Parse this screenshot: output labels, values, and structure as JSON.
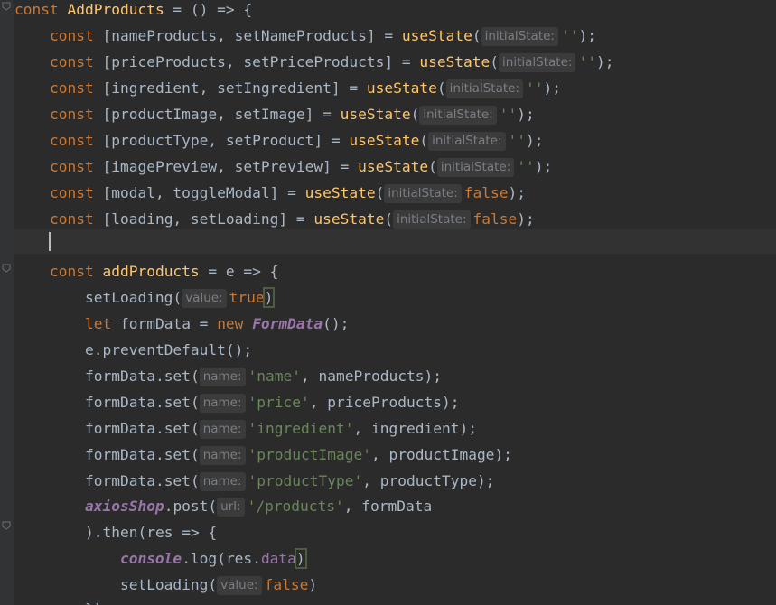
{
  "editor": {
    "indent": "    ",
    "hint_labels": {
      "initial_state": "initialState:",
      "value": "value:",
      "name": "name:",
      "url": "url:"
    },
    "keywords": {
      "const": "const",
      "let": "let",
      "new": "new"
    },
    "lines": {
      "l1": {
        "name": "AddProducts",
        "rest": " = () => {"
      },
      "l2": {
        "destructure": "[nameProducts, setNameProducts]",
        "call": "useState",
        "arg": "''"
      },
      "l3": {
        "destructure": "[priceProducts, setPriceProducts]",
        "call": "useState",
        "arg": "''"
      },
      "l4": {
        "destructure": "[ingredient, setIngredient]",
        "call": "useState",
        "arg": "''"
      },
      "l5": {
        "destructure": "[productImage, setImage]",
        "call": "useState",
        "arg": "''"
      },
      "l6": {
        "destructure": "[productType, setProduct]",
        "call": "useState",
        "arg": "''"
      },
      "l7": {
        "destructure": "[imagePreview, setPreview]",
        "call": "useState",
        "arg": "''"
      },
      "l8": {
        "destructure": "[modal, toggleModal]",
        "call": "useState",
        "arg": "false"
      },
      "l9": {
        "destructure": "[loading, setLoading]",
        "call": "useState",
        "arg": "false"
      },
      "l11": {
        "name": "addProducts",
        "rest": " = e => {"
      },
      "l12": {
        "call": "setLoading",
        "arg": "true"
      },
      "l13": {
        "var": "formData",
        "cls": "FormData"
      },
      "l14": {
        "obj": "e",
        "method": "preventDefault"
      },
      "l15": {
        "obj": "formData",
        "method": "set",
        "key": "'name'",
        "val": "nameProducts"
      },
      "l16": {
        "obj": "formData",
        "method": "set",
        "key": "'price'",
        "val": "priceProducts"
      },
      "l17": {
        "obj": "formData",
        "method": "set",
        "key": "'ingredient'",
        "val": "ingredient"
      },
      "l18": {
        "obj": "formData",
        "method": "set",
        "key": "'productImage'",
        "val": "productImage"
      },
      "l19": {
        "obj": "formData",
        "method": "set",
        "key": "'productType'",
        "val": "productType"
      },
      "l20": {
        "obj": "axiosShop",
        "method": "post",
        "url": "'/products'",
        "val": "formData"
      },
      "l21": {
        "method": "then",
        "param": "res"
      },
      "l22": {
        "obj": "console",
        "method": "log",
        "arg_obj": "res",
        "arg_prop": "data"
      },
      "l23": {
        "call": "setLoading",
        "arg": "false"
      },
      "l24": {
        "text": "})"
      }
    }
  }
}
